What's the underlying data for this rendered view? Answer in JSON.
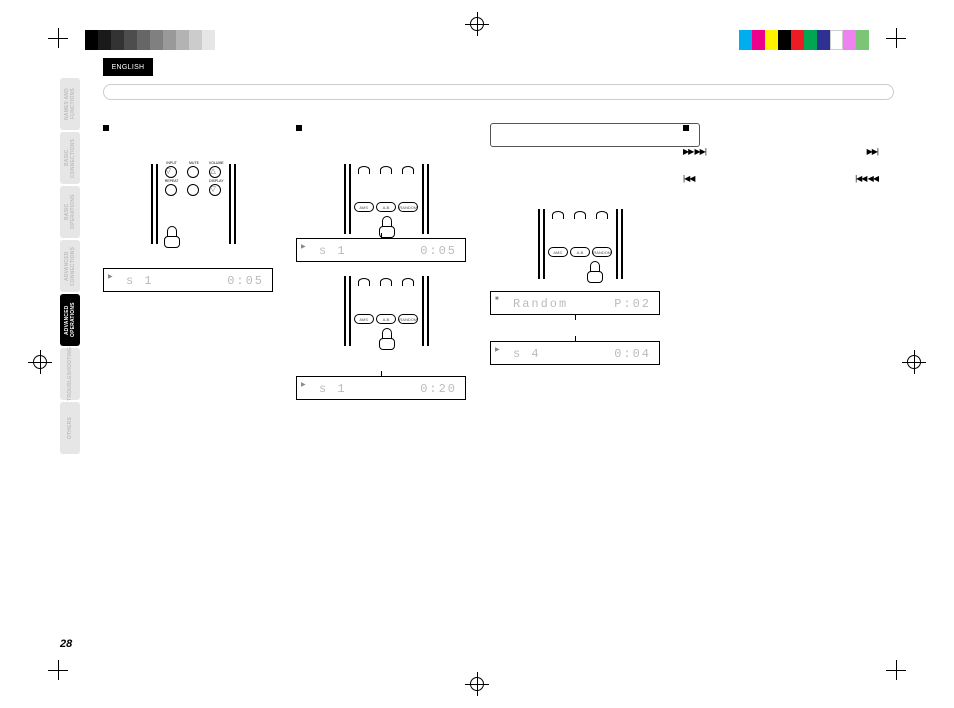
{
  "lang_tab": "ENGLISH",
  "page_number": "28",
  "side_tabs": [
    {
      "label": "NAMES AND\nFUNCTIONS",
      "active": false
    },
    {
      "label": "BASIC\nCONNECTIONS",
      "active": false
    },
    {
      "label": "BASIC\nOPERATIONS",
      "active": false
    },
    {
      "label": "ADVANCED\nCONNECTIONS",
      "active": false
    },
    {
      "label": "ADVANCED\nOPERATIONS",
      "active": true
    },
    {
      "label": "TROUBLESHOOTING",
      "active": false
    },
    {
      "label": "OTHERS",
      "active": false
    }
  ],
  "remote_top_labels": [
    "INPUT",
    "MUTE",
    "VOLUME"
  ],
  "remote_mid_labels": [
    "REPEAT",
    "",
    "DISPLAY"
  ],
  "remote_bottom_labels": [
    "AMS",
    "A-B",
    "RANDOM"
  ],
  "sections": {
    "s1_title": "",
    "s2_title": "",
    "s3_title": ""
  },
  "note_box": "",
  "icon_rows": {
    "r1_left": "▶▶ ▶▶|",
    "r1_right": "▶▶|",
    "r2_left": "|◀◀",
    "r2_right": "|◀◀ ◀◀"
  },
  "lcds": {
    "d1": {
      "mini": "▶",
      "left": "s  1",
      "right": "0:05"
    },
    "d2": {
      "mini": "▶",
      "left": "s  1",
      "right": "0:05"
    },
    "d3": {
      "mini": "▶",
      "left": "s  1",
      "right": "0:20"
    },
    "d4": {
      "mini": "■",
      "left": "Random",
      "right": "P:02"
    },
    "d5": {
      "mini": "▶",
      "left": "s  4",
      "right": "0:04"
    }
  }
}
